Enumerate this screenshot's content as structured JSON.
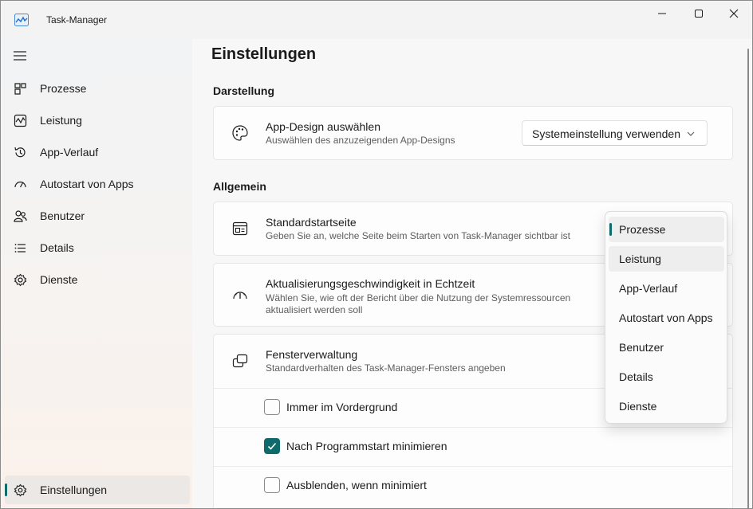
{
  "window": {
    "title": "Task-Manager",
    "controls": {
      "minimize": "minimize-icon",
      "maximize": "maximize-icon",
      "close": "close-icon"
    }
  },
  "sidebar": {
    "menu_icon": "hamburger-icon",
    "items": [
      {
        "label": "Prozesse",
        "icon": "processes-icon"
      },
      {
        "label": "Leistung",
        "icon": "performance-icon"
      },
      {
        "label": "App-Verlauf",
        "icon": "history-icon"
      },
      {
        "label": "Autostart von Apps",
        "icon": "startup-gauge-icon"
      },
      {
        "label": "Benutzer",
        "icon": "users-icon"
      },
      {
        "label": "Details",
        "icon": "details-list-icon"
      },
      {
        "label": "Dienste",
        "icon": "services-gear-icon"
      }
    ],
    "settings": {
      "label": "Einstellungen",
      "icon": "settings-gear-icon",
      "active": true
    }
  },
  "main": {
    "title": "Einstellungen",
    "sections": {
      "appearance": {
        "title": "Darstellung",
        "app_design": {
          "title": "App-Design auswählen",
          "description": "Auswählen des anzuzeigenden App-Designs",
          "value": "Systemeinstellung verwenden",
          "icon": "palette-icon"
        }
      },
      "general": {
        "title": "Allgemein",
        "start_page": {
          "title": "Standardstartseite",
          "description": "Geben Sie an, welche Seite beim Starten von Task-Manager sichtbar ist",
          "icon": "start-page-icon"
        },
        "update_speed": {
          "title": "Aktualisierungsgeschwindigkeit in Echtzeit",
          "description_line1": "Wählen Sie, wie oft der Bericht über die Nutzung der Systemressourcen",
          "description_line2": "aktualisiert werden soll",
          "icon": "speed-gauge-icon"
        },
        "window_management": {
          "title": "Fensterverwaltung",
          "description": "Standardverhalten des Task-Manager-Fensters angeben",
          "icon": "window-stack-icon",
          "options": [
            {
              "label": "Immer im Vordergrund",
              "checked": false
            },
            {
              "label": "Nach Programmstart minimieren",
              "checked": true
            },
            {
              "label": "Ausblenden, wenn minimiert",
              "checked": false
            }
          ]
        }
      }
    }
  },
  "start_page_dropdown": {
    "options": [
      "Prozesse",
      "Leistung",
      "App-Verlauf",
      "Autostart von Apps",
      "Benutzer",
      "Details",
      "Dienste"
    ],
    "selected": "Prozesse",
    "hovered": "Leistung"
  },
  "colors": {
    "accent": "#0f6b6b",
    "sidebar_bg": "#f6f3f1",
    "content_bg": "#f7f7f7",
    "card_bg": "#fdfdfd"
  }
}
